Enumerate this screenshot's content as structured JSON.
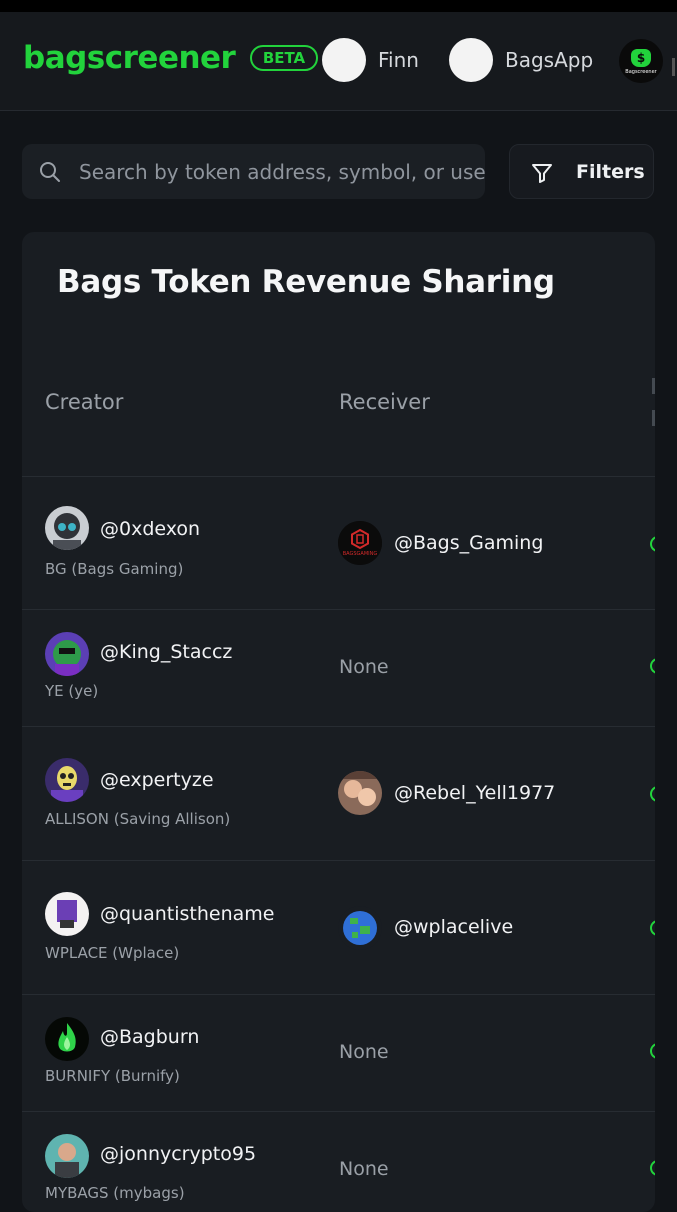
{
  "header": {
    "logo": "bagscreener",
    "badge": "BETA",
    "links": [
      {
        "label": "Finn"
      },
      {
        "label": "BagsApp"
      }
    ],
    "app_logo_text": "Bagscreener"
  },
  "search": {
    "placeholder": "Search by token address, symbol, or username",
    "icon": "search-icon"
  },
  "filters": {
    "label": "Filters",
    "icon": "filter-icon"
  },
  "table": {
    "title": "Bags Token Revenue Sharing",
    "columns": [
      "Creator",
      "Receiver"
    ],
    "rows": [
      {
        "creator": "@0xdexon",
        "token": "BG (Bags Gaming)",
        "receiver": "@Bags_Gaming",
        "receiver_avatar_text": "BAGSGAMING"
      },
      {
        "creator": "@King_Staccz",
        "token": "YE (ye)",
        "receiver": "None"
      },
      {
        "creator": "@expertyze",
        "token": "ALLISON (Saving Allison)",
        "receiver": "@Rebel_Yell1977"
      },
      {
        "creator": "@quantisthename",
        "token": "WPLACE (Wplace)",
        "receiver": "@wplacelive"
      },
      {
        "creator": "@Bagburn",
        "token": "BURNIFY (Burnify)",
        "receiver": "None"
      },
      {
        "creator": "@jonnycrypto95",
        "token": "MYBAGS (mybags)",
        "receiver": "None"
      }
    ]
  },
  "colors": {
    "accent": "#22d33c",
    "background": "#111418",
    "card": "#191d22"
  }
}
